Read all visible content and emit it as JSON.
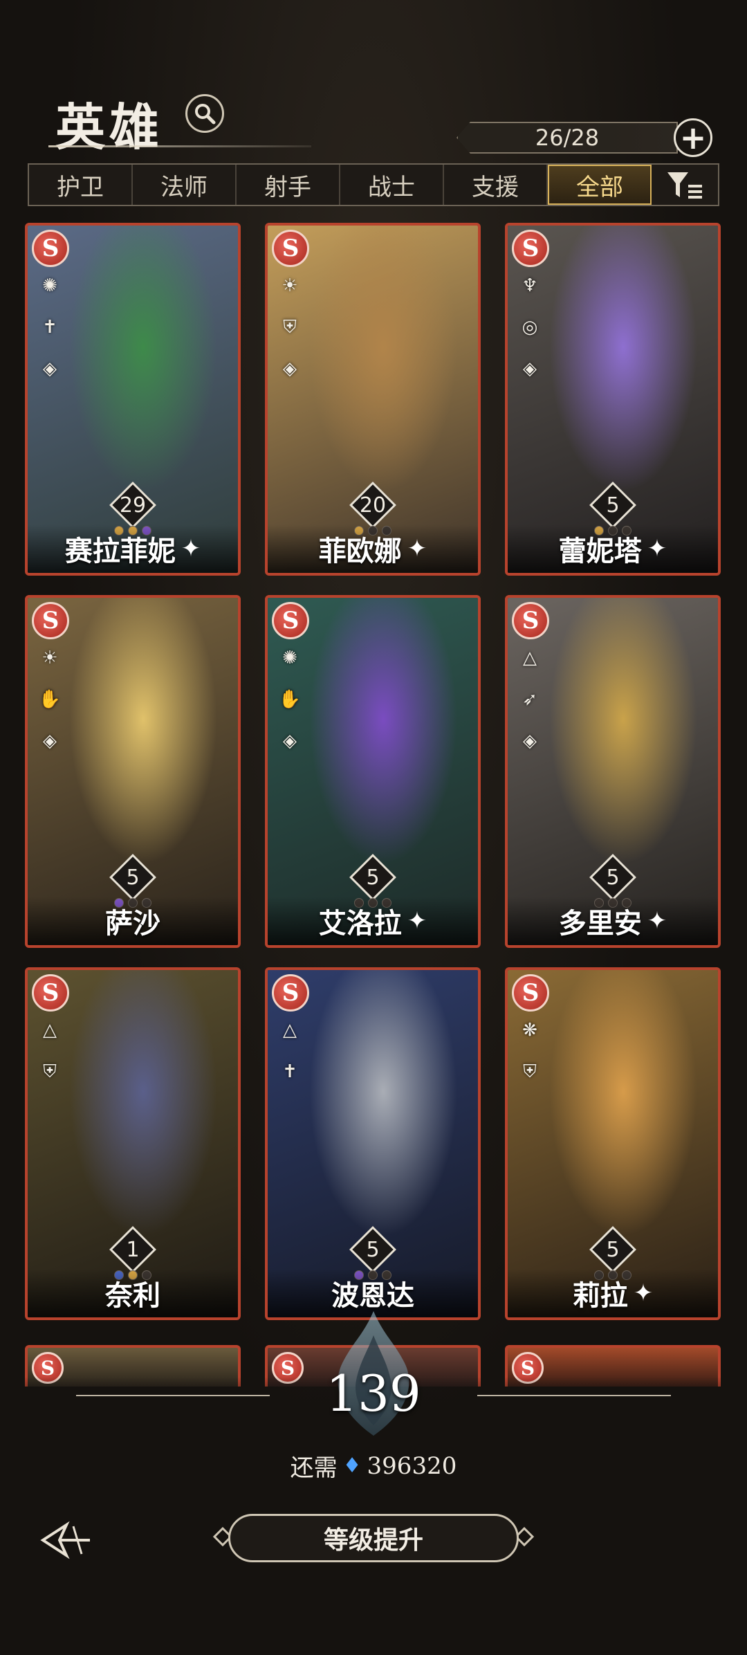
{
  "header": {
    "title": "英雄",
    "count": "26/28"
  },
  "tabs": [
    {
      "label": "护卫",
      "active": false
    },
    {
      "label": "法师",
      "active": false
    },
    {
      "label": "射手",
      "active": false
    },
    {
      "label": "战士",
      "active": false
    },
    {
      "label": "支援",
      "active": false
    },
    {
      "label": "全部",
      "active": true
    }
  ],
  "heroes": [
    {
      "name": "赛拉菲妮",
      "level": "29",
      "starred": true,
      "stars": [
        "gold",
        "gold",
        "purple"
      ],
      "bg": [
        "#5b6a86",
        "#2f3d3b"
      ],
      "accent": "#3e8a4a"
    },
    {
      "name": "菲欧娜",
      "level": "20",
      "starred": true,
      "stars": [
        "gold",
        "none",
        "none"
      ],
      "bg": [
        "#c39d5a",
        "#3f342a"
      ],
      "accent": "#b1844a"
    },
    {
      "name": "蕾妮塔",
      "level": "5",
      "starred": true,
      "stars": [
        "gold",
        "none",
        "none"
      ],
      "bg": [
        "#5a5550",
        "#232020"
      ],
      "accent": "#8e6fd0"
    },
    {
      "name": "萨沙",
      "level": "5",
      "starred": false,
      "stars": [
        "purple",
        "none",
        "none"
      ],
      "bg": [
        "#7a6540",
        "#2a231b"
      ],
      "accent": "#e0c16a"
    },
    {
      "name": "艾洛拉",
      "level": "5",
      "starred": true,
      "stars": [
        "none",
        "none",
        "none"
      ],
      "bg": [
        "#2f5a52",
        "#1d2a28"
      ],
      "accent": "#7a4cc0"
    },
    {
      "name": "多里安",
      "level": "5",
      "starred": true,
      "stars": [
        "none",
        "none",
        "none"
      ],
      "bg": [
        "#6b6560",
        "#25221f"
      ],
      "accent": "#c9a24a"
    },
    {
      "name": "奈利",
      "level": "1",
      "starred": false,
      "stars": [
        "blue",
        "gold",
        "none"
      ],
      "bg": [
        "#5d5230",
        "#1e1a14"
      ],
      "accent": "#5a5f8a"
    },
    {
      "name": "波恩达",
      "level": "5",
      "starred": false,
      "stars": [
        "purple",
        "none",
        "none"
      ],
      "bg": [
        "#2f3d6a",
        "#161a28"
      ],
      "accent": "#a9adb5"
    },
    {
      "name": "莉拉",
      "level": "5",
      "starred": true,
      "stars": [
        "none",
        "none",
        "none"
      ],
      "bg": [
        "#8a6a35",
        "#2a2016"
      ],
      "accent": "#d69b4a"
    }
  ],
  "bottom": {
    "total_level": "139",
    "require_label": "还需",
    "require_amount": "396320",
    "upgrade_label": "等级提升"
  },
  "colors": {
    "card_border": "#b8432d",
    "active_tab": "#d8b25a"
  }
}
